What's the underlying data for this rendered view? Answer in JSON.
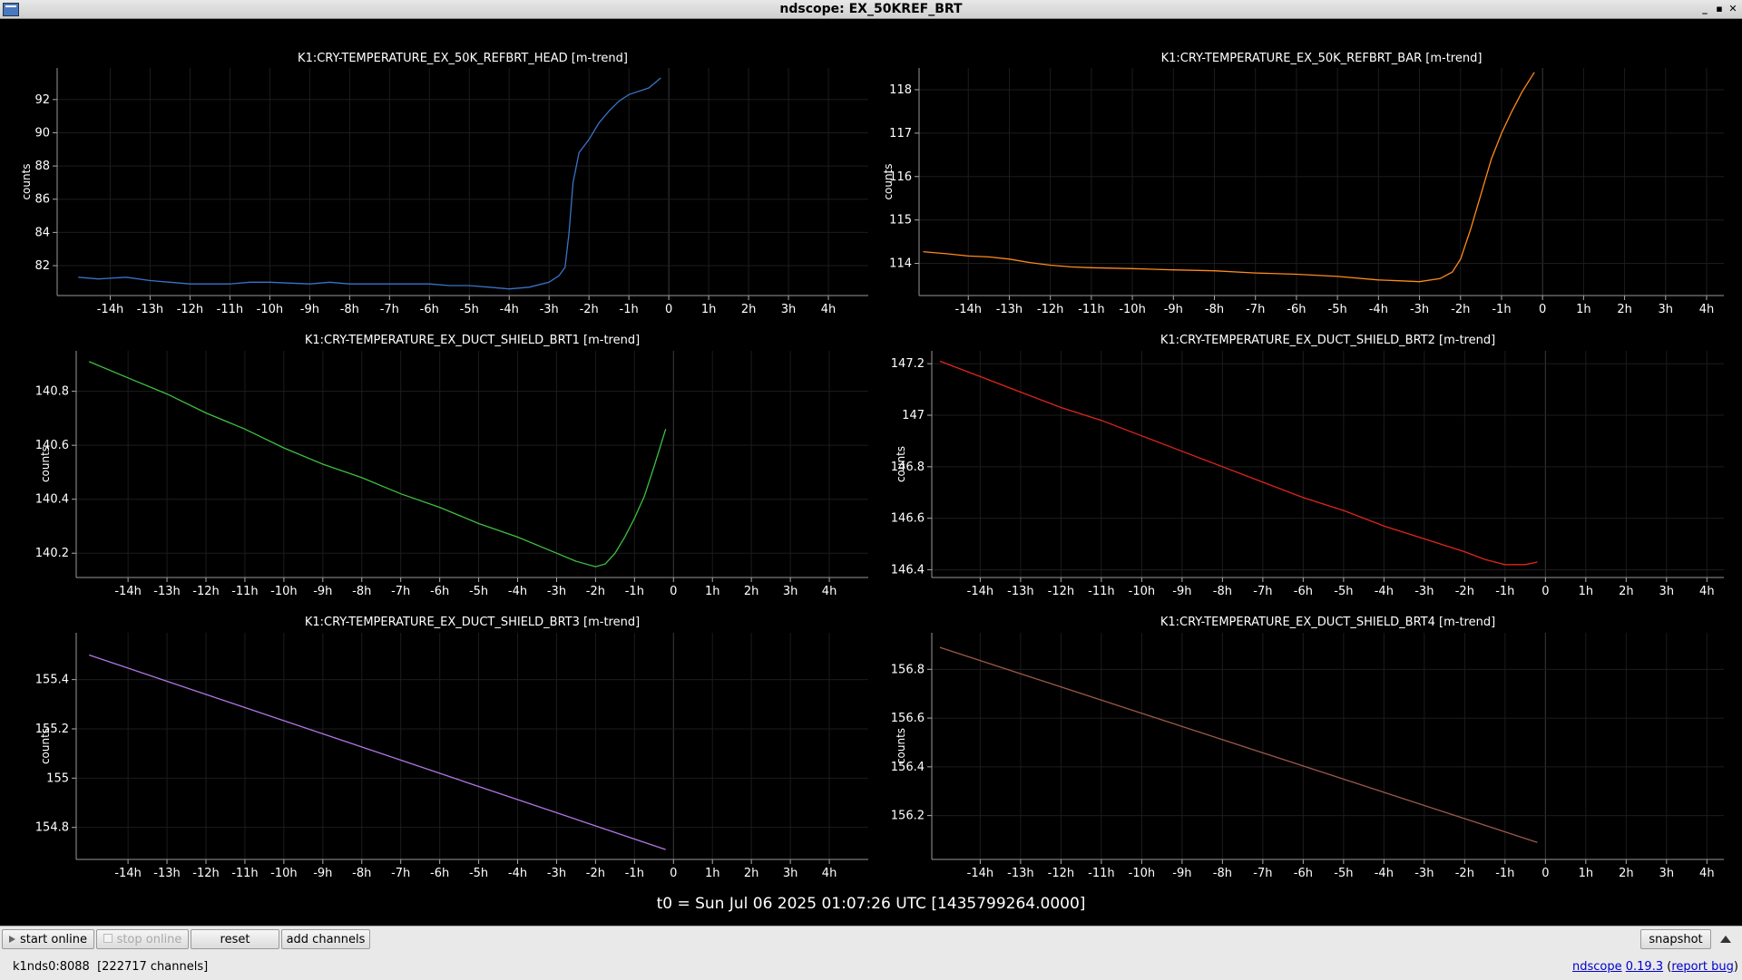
{
  "window": {
    "title": "ndscope: EX_50KREF_BRT",
    "buttons": [
      "_",
      "▪",
      "✕"
    ]
  },
  "x_ticks": [
    "-14h",
    "-13h",
    "-12h",
    "-11h",
    "-10h",
    "-9h",
    "-8h",
    "-7h",
    "-6h",
    "-5h",
    "-4h",
    "-3h",
    "-2h",
    "-1h",
    "0",
    "1h",
    "2h",
    "3h",
    "4h"
  ],
  "plots": [
    {
      "title": "K1:CRY-TEMPERATURE_EX_50K_REFBRT_HEAD [m-trend]",
      "ylabel": "counts",
      "color": "#3a73c8",
      "ylim": [
        80.2,
        93.9
      ],
      "yticks": [
        "82",
        "84",
        "86",
        "88",
        "90",
        "92"
      ],
      "series": [
        [
          -14.8,
          81.3
        ],
        [
          -14.3,
          81.2
        ],
        [
          -13.6,
          81.3
        ],
        [
          -13,
          81.1
        ],
        [
          -12.5,
          81
        ],
        [
          -12,
          80.9
        ],
        [
          -11,
          80.9
        ],
        [
          -10.5,
          81
        ],
        [
          -10,
          81
        ],
        [
          -9,
          80.9
        ],
        [
          -8.5,
          81
        ],
        [
          -8,
          80.9
        ],
        [
          -7,
          80.9
        ],
        [
          -6,
          80.9
        ],
        [
          -5.5,
          80.8
        ],
        [
          -5,
          80.8
        ],
        [
          -4.5,
          80.7
        ],
        [
          -4,
          80.6
        ],
        [
          -3.5,
          80.7
        ],
        [
          -3,
          81
        ],
        [
          -2.75,
          81.4
        ],
        [
          -2.6,
          81.9
        ],
        [
          -2.5,
          84
        ],
        [
          -2.4,
          87
        ],
        [
          -2.25,
          88.8
        ],
        [
          -2,
          89.6
        ],
        [
          -1.75,
          90.6
        ],
        [
          -1.5,
          91.3
        ],
        [
          -1.25,
          91.9
        ],
        [
          -1,
          92.3
        ],
        [
          -0.5,
          92.7
        ],
        [
          -0.2,
          93.3
        ]
      ]
    },
    {
      "title": "K1:CRY-TEMPERATURE_EX_50K_REFBRT_BAR [m-trend]",
      "ylabel": "counts",
      "color": "#ff8a1a",
      "ylim": [
        113.26,
        118.5
      ],
      "yticks": [
        "114",
        "115",
        "116",
        "117",
        "118"
      ],
      "series": [
        [
          -15.1,
          114.27
        ],
        [
          -14.5,
          114.22
        ],
        [
          -14,
          114.17
        ],
        [
          -13.5,
          114.15
        ],
        [
          -13,
          114.1
        ],
        [
          -12.5,
          114.02
        ],
        [
          -12,
          113.96
        ],
        [
          -11.5,
          113.92
        ],
        [
          -11,
          113.9
        ],
        [
          -10,
          113.88
        ],
        [
          -9,
          113.85
        ],
        [
          -8,
          113.83
        ],
        [
          -7,
          113.78
        ],
        [
          -6,
          113.75
        ],
        [
          -5,
          113.7
        ],
        [
          -4,
          113.62
        ],
        [
          -3.5,
          113.6
        ],
        [
          -3,
          113.58
        ],
        [
          -2.5,
          113.65
        ],
        [
          -2.2,
          113.8
        ],
        [
          -2,
          114.1
        ],
        [
          -1.75,
          114.8
        ],
        [
          -1.5,
          115.6
        ],
        [
          -1.25,
          116.4
        ],
        [
          -1,
          117
        ],
        [
          -0.75,
          117.5
        ],
        [
          -0.5,
          117.95
        ],
        [
          -0.2,
          118.4
        ]
      ]
    },
    {
      "title": "K1:CRY-TEMPERATURE_EX_DUCT_SHIELD_BRT1 [m-trend]",
      "ylabel": "counts",
      "color": "#3fbf3f",
      "ylim": [
        140.11,
        140.95
      ],
      "yticks": [
        "140.2",
        "140.4",
        "140.6",
        "140.8"
      ],
      "series": [
        [
          -15,
          140.91
        ],
        [
          -14,
          140.85
        ],
        [
          -13,
          140.79
        ],
        [
          -12,
          140.72
        ],
        [
          -11,
          140.66
        ],
        [
          -10,
          140.59
        ],
        [
          -9,
          140.53
        ],
        [
          -8,
          140.48
        ],
        [
          -7,
          140.42
        ],
        [
          -6,
          140.37
        ],
        [
          -5,
          140.31
        ],
        [
          -4,
          140.26
        ],
        [
          -3,
          140.2
        ],
        [
          -2.5,
          140.17
        ],
        [
          -2,
          140.15
        ],
        [
          -1.75,
          140.16
        ],
        [
          -1.5,
          140.2
        ],
        [
          -1.25,
          140.26
        ],
        [
          -1,
          140.33
        ],
        [
          -0.75,
          140.41
        ],
        [
          -0.5,
          140.52
        ],
        [
          -0.2,
          140.66
        ]
      ]
    },
    {
      "title": "K1:CRY-TEMPERATURE_EX_DUCT_SHIELD_BRT2 [m-trend]",
      "ylabel": "counts",
      "color": "#e0251b",
      "ylim": [
        146.37,
        147.25
      ],
      "yticks": [
        "146.4",
        "146.6",
        "146.8",
        "147",
        "147.2"
      ],
      "series": [
        [
          -15,
          147.21
        ],
        [
          -14,
          147.15
        ],
        [
          -13,
          147.09
        ],
        [
          -12,
          147.03
        ],
        [
          -11,
          146.98
        ],
        [
          -10,
          146.92
        ],
        [
          -9,
          146.86
        ],
        [
          -8,
          146.8
        ],
        [
          -7,
          146.74
        ],
        [
          -6,
          146.68
        ],
        [
          -5,
          146.63
        ],
        [
          -4,
          146.57
        ],
        [
          -3,
          146.52
        ],
        [
          -2,
          146.47
        ],
        [
          -1.5,
          146.44
        ],
        [
          -1,
          146.42
        ],
        [
          -0.5,
          146.42
        ],
        [
          -0.2,
          146.43
        ]
      ]
    },
    {
      "title": "K1:CRY-TEMPERATURE_EX_DUCT_SHIELD_BRT3 [m-trend]",
      "ylabel": "counts",
      "color": "#b077e6",
      "ylim": [
        154.67,
        155.59
      ],
      "yticks": [
        "154.8",
        "155",
        "155.2",
        "155.4"
      ],
      "series": [
        [
          -15,
          155.5
        ],
        [
          -0.2,
          154.71
        ]
      ]
    },
    {
      "title": "K1:CRY-TEMPERATURE_EX_DUCT_SHIELD_BRT4 [m-trend]",
      "ylabel": "counts",
      "color": "#9a5a4a",
      "ylim": [
        156.02,
        156.95
      ],
      "yticks": [
        "156.2",
        "156.4",
        "156.6",
        "156.8"
      ],
      "series": [
        [
          -15,
          156.89
        ],
        [
          -0.2,
          156.09
        ]
      ]
    }
  ],
  "t0_label": "t0 = Sun Jul 06 2025 01:07:26 UTC [1435799264.0000]",
  "toolbar": {
    "start_online": "start online",
    "stop_online": "stop online",
    "reset": "reset",
    "add_channels": "add channels",
    "snapshot": "snapshot"
  },
  "status": {
    "server": "k1nds0:8088",
    "channels": "[222717 channels]",
    "app_name": "ndscope",
    "version": "0.19.3",
    "report_bug": "report bug"
  }
}
